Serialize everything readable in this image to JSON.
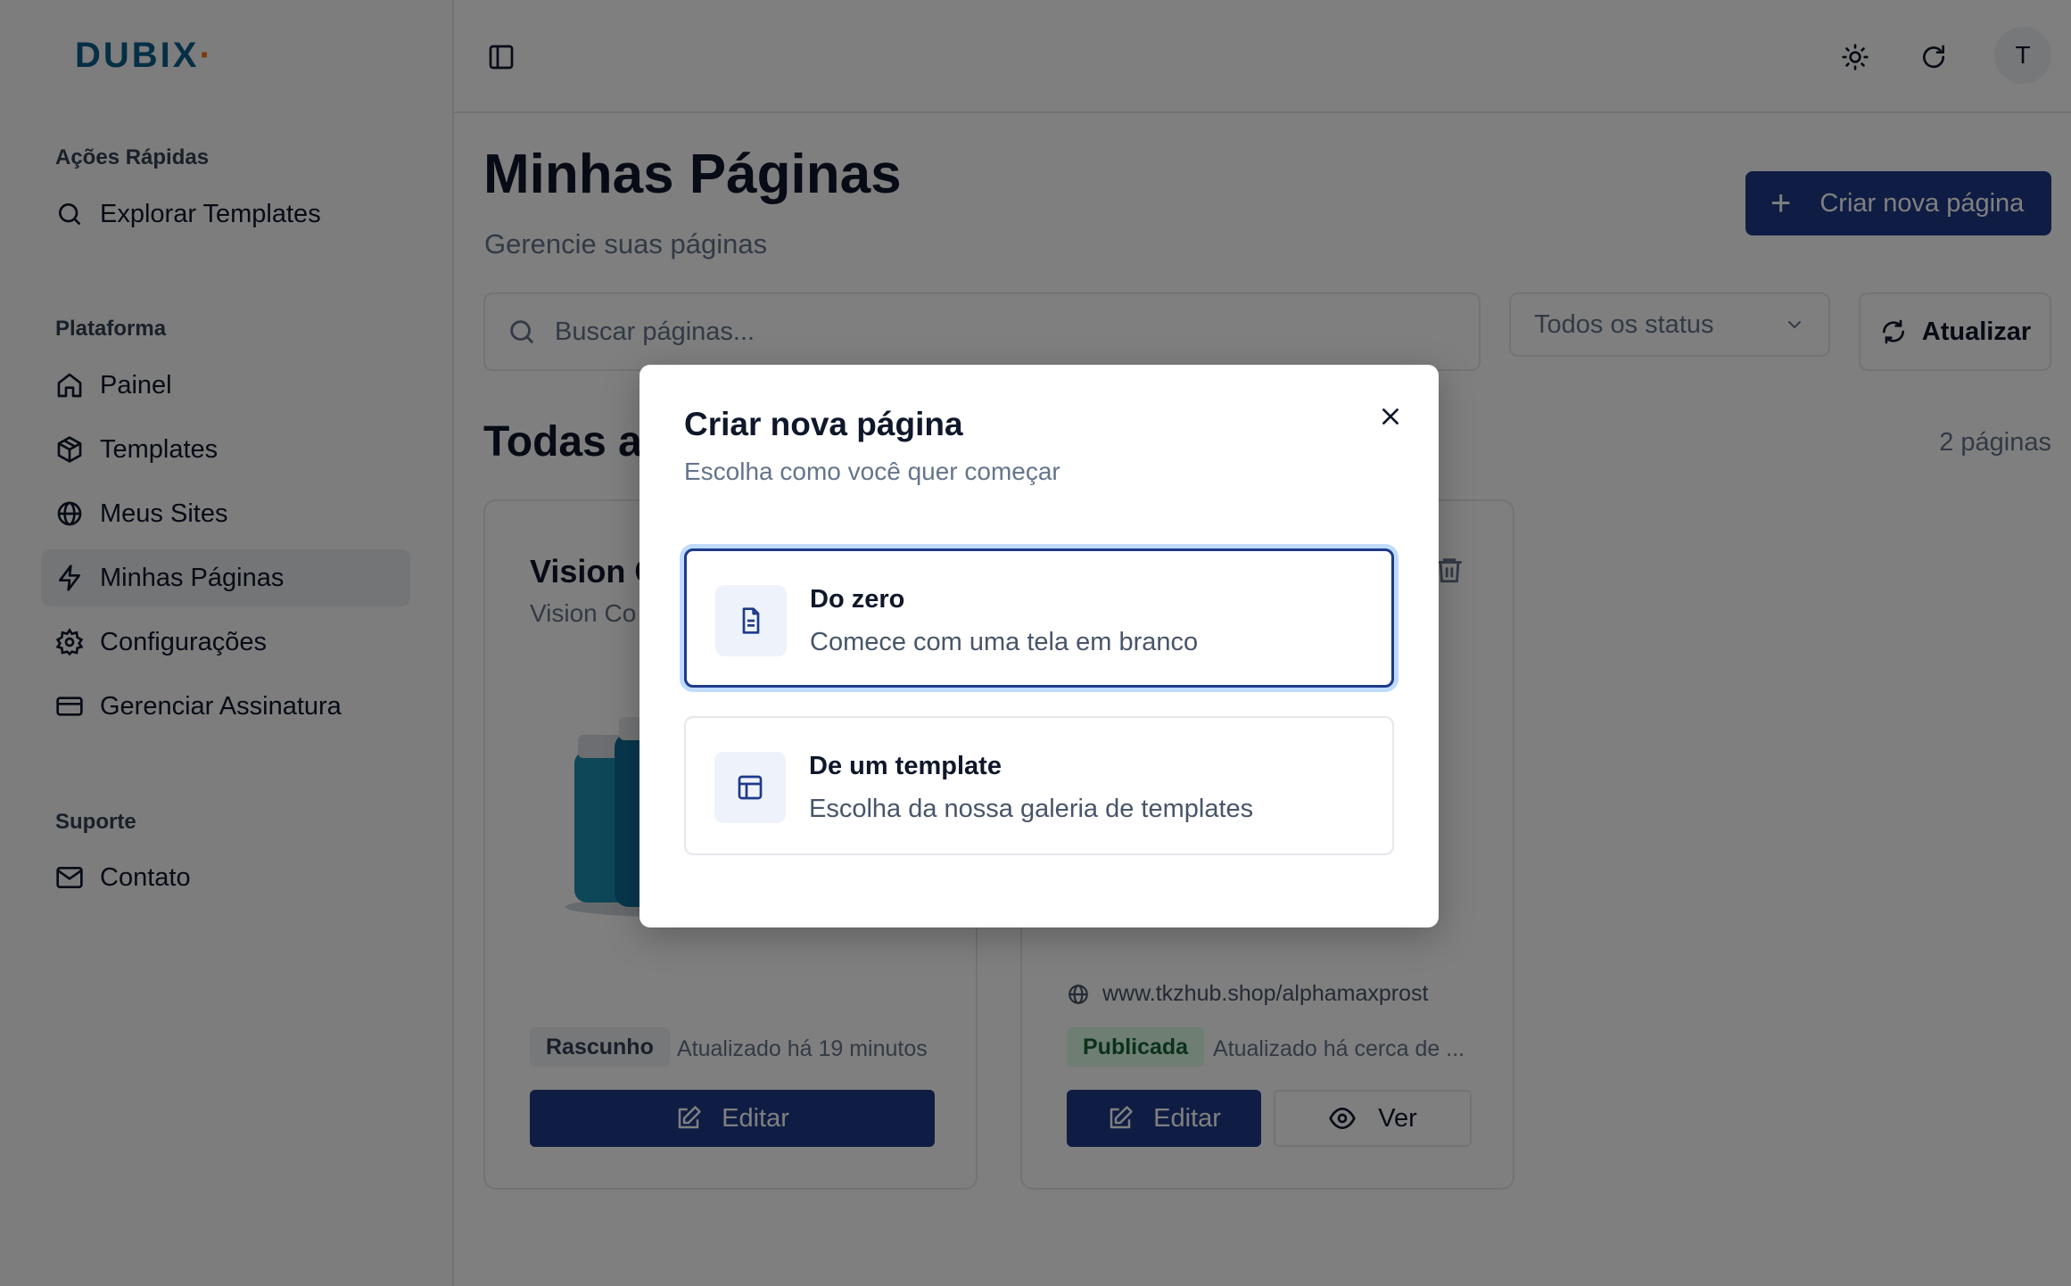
{
  "brand": {
    "name": "DUBIX",
    "dot": "·"
  },
  "sidebar": {
    "sections": [
      {
        "title": "Ações Rápidas",
        "items": [
          {
            "label": "Explorar Templates",
            "icon": "search-icon"
          }
        ]
      },
      {
        "title": "Plataforma",
        "items": [
          {
            "label": "Painel",
            "icon": "home-icon"
          },
          {
            "label": "Templates",
            "icon": "package-icon"
          },
          {
            "label": "Meus Sites",
            "icon": "globe-icon"
          },
          {
            "label": "Minhas Páginas",
            "icon": "zap-icon",
            "active": true
          },
          {
            "label": "Configurações",
            "icon": "gear-icon"
          },
          {
            "label": "Gerenciar Assinatura",
            "icon": "credit-card-icon"
          }
        ]
      },
      {
        "title": "Suporte",
        "items": [
          {
            "label": "Contato",
            "icon": "mail-icon"
          }
        ]
      }
    ]
  },
  "topbar": {
    "avatar_initial": "T"
  },
  "main": {
    "title": "Minhas Páginas",
    "subtitle": "Gerencie suas páginas",
    "create_label": "Criar nova página",
    "search_placeholder": "Buscar páginas...",
    "status_filter": "Todos os status",
    "refresh_label": "Atualizar",
    "section_heading": "Todas as",
    "count": "2 páginas"
  },
  "cards": [
    {
      "title": "Vision C",
      "subtitle": "Vision Co",
      "status": "Rascunho",
      "updated": "Atualizado há 19 minutos",
      "edit_label": "Editar"
    },
    {
      "url": "www.tkzhub.shop/alphamaxprost",
      "status": "Publicada",
      "updated": "Atualizado há cerca de ...",
      "edit_label": "Editar",
      "view_label": "Ver"
    }
  ],
  "modal": {
    "title": "Criar nova página",
    "subtitle": "Escolha como você quer começar",
    "options": [
      {
        "title": "Do zero",
        "description": "Comece com uma tela em branco",
        "icon": "file-text-icon",
        "selected": true
      },
      {
        "title": "De um template",
        "description": "Escolha da nossa galeria de templates",
        "icon": "layout-icon",
        "selected": false
      }
    ]
  },
  "colors": {
    "primary": "#1e3a8a",
    "brand": "#0b5f8a",
    "brand_dot": "#f97316",
    "published_bg": "#dcfce7",
    "published_text": "#166534",
    "overlay": "rgba(0,0,0,0.5)"
  }
}
